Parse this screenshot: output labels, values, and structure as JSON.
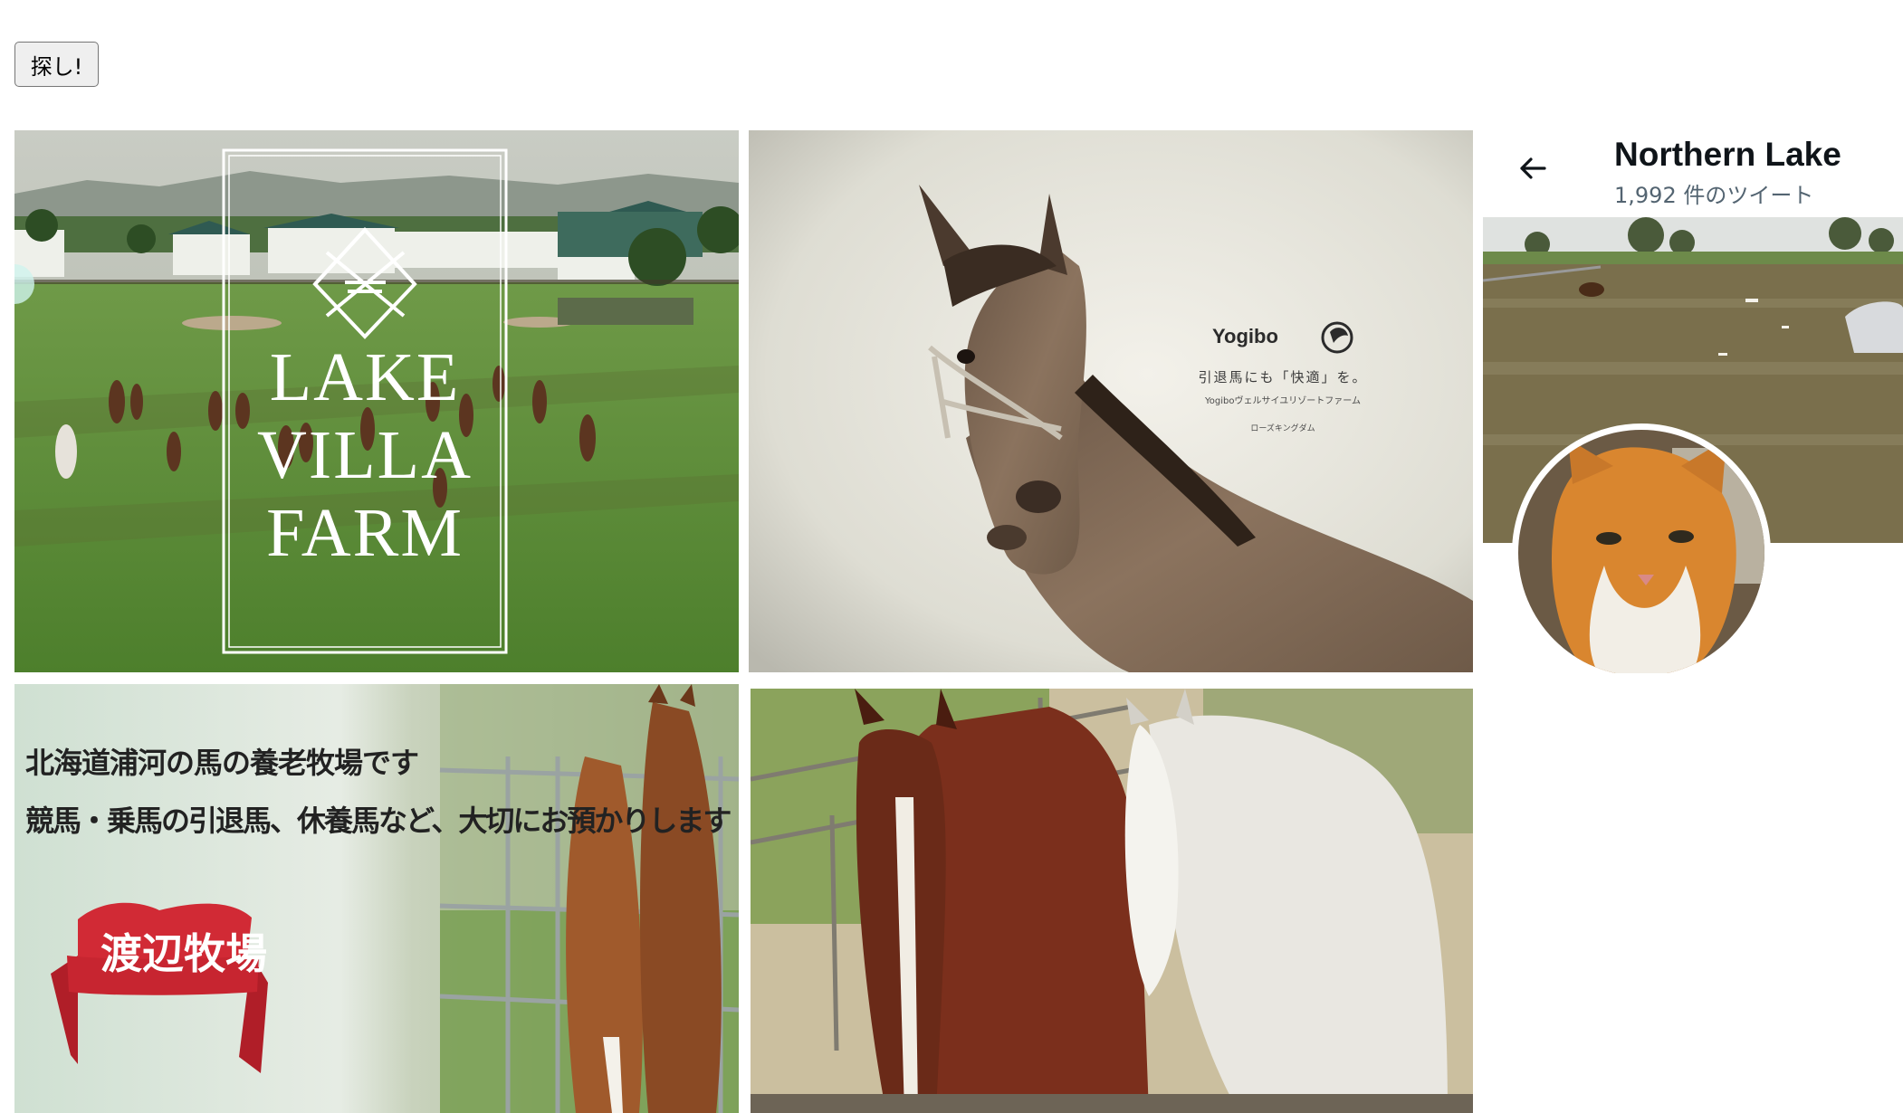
{
  "search": {
    "button_label": "探し!"
  },
  "tiles": {
    "lake_villa": {
      "logo_line1": "LAKE",
      "logo_line2": "VILLA",
      "logo_line3": "FARM"
    },
    "yogibo": {
      "brand": "Yogibo",
      "headline": "引退馬にも「快適」を。",
      "subline": "Yogiboヴェルサイユリゾートファーム",
      "caption": "ローズキングダム"
    },
    "watanabe": {
      "line1": "北海道浦河の馬の養老牧場です",
      "line2": "競馬・乗馬の引退馬、休養馬など、大切にお預かりします",
      "ribbon": "渡辺牧場"
    }
  },
  "profile": {
    "name": "Northern Lake",
    "tweet_count": "1,992 件のツイート"
  },
  "colors": {
    "accent_red": "#d12a35",
    "text_dark": "#0f1419",
    "text_muted": "#536471"
  }
}
